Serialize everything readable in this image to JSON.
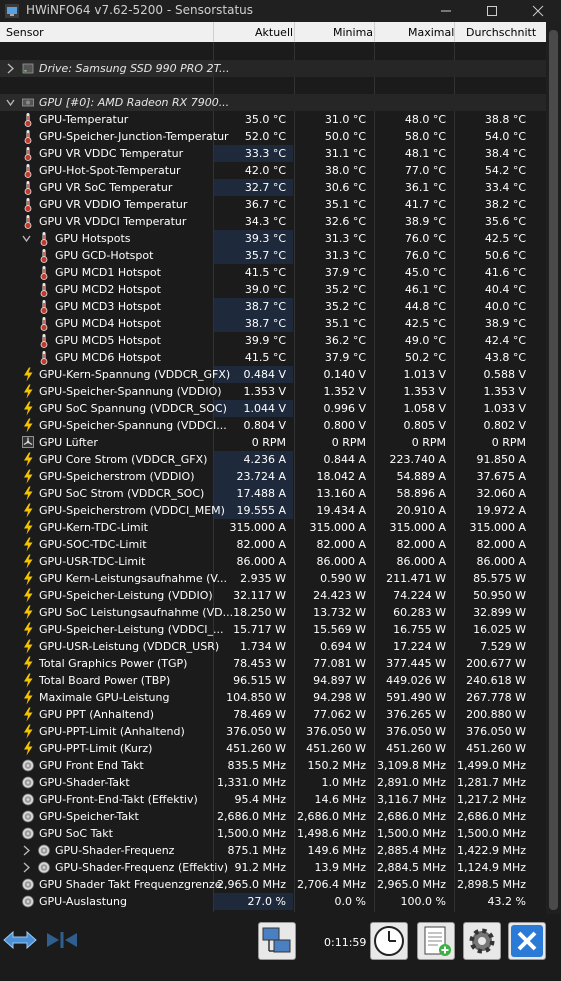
{
  "window": {
    "title": "HWiNFO64 v7.62-5200 - Sensorstatus"
  },
  "columns": {
    "sensor": "Sensor",
    "current": "Aktuell",
    "min": "Minimal",
    "max": "Maximal",
    "avg": "Durchschnitt"
  },
  "groups": [
    {
      "label": "Drive: Samsung SSD 990 PRO 2T..."
    },
    {
      "label": "GPU [#0]: AMD Radeon RX 7900..."
    }
  ],
  "rows": [
    {
      "name": "GPU-Temperatur",
      "icon": "thermometer-icon",
      "cur": "35.0 °C",
      "min": "31.0 °C",
      "max": "48.0 °C",
      "avg": "38.8 °C"
    },
    {
      "name": "GPU-Speicher-Junction-Temperatur",
      "icon": "thermometer-icon",
      "cur": "52.0 °C",
      "min": "50.0 °C",
      "max": "58.0 °C",
      "avg": "54.0 °C"
    },
    {
      "name": "GPU VR VDDC Temperatur",
      "icon": "thermometer-icon",
      "cur": "33.3 °C",
      "min": "31.1 °C",
      "max": "48.1 °C",
      "avg": "38.4 °C",
      "bar": true
    },
    {
      "name": "GPU-Hot-Spot-Temperatur",
      "icon": "thermometer-icon",
      "cur": "42.0 °C",
      "min": "38.0 °C",
      "max": "77.0 °C",
      "avg": "54.2 °C"
    },
    {
      "name": "GPU VR SoC Temperatur",
      "icon": "thermometer-icon",
      "cur": "32.7 °C",
      "min": "30.6 °C",
      "max": "36.1 °C",
      "avg": "33.4 °C",
      "bar": true
    },
    {
      "name": "GPU VR VDDIO Temperatur",
      "icon": "thermometer-icon",
      "cur": "36.7 °C",
      "min": "35.1 °C",
      "max": "41.7 °C",
      "avg": "38.2 °C"
    },
    {
      "name": "GPU VR VDDCI Temperatur",
      "icon": "thermometer-icon",
      "cur": "34.3 °C",
      "min": "32.6 °C",
      "max": "38.9 °C",
      "avg": "35.6 °C"
    },
    {
      "name": "GPU Hotspots",
      "icon": "thermometer-icon",
      "cur": "39.3 °C",
      "min": "31.3 °C",
      "max": "76.0 °C",
      "avg": "42.5 °C",
      "indent": 1,
      "expander": "down",
      "bar": true
    },
    {
      "name": "GPU GCD-Hotspot",
      "icon": "thermometer-icon",
      "cur": "35.7 °C",
      "min": "31.3 °C",
      "max": "76.0 °C",
      "avg": "50.6 °C",
      "indent": 1,
      "bar": true
    },
    {
      "name": "GPU MCD1 Hotspot",
      "icon": "thermometer-icon",
      "cur": "41.5 °C",
      "min": "37.9 °C",
      "max": "45.0 °C",
      "avg": "41.6 °C",
      "indent": 1
    },
    {
      "name": "GPU MCD2 Hotspot",
      "icon": "thermometer-icon",
      "cur": "39.0 °C",
      "min": "35.2 °C",
      "max": "46.1 °C",
      "avg": "40.4 °C",
      "indent": 1
    },
    {
      "name": "GPU MCD3 Hotspot",
      "icon": "thermometer-icon",
      "cur": "38.7 °C",
      "min": "35.2 °C",
      "max": "44.8 °C",
      "avg": "40.0 °C",
      "indent": 1,
      "bar": true
    },
    {
      "name": "GPU MCD4 Hotspot",
      "icon": "thermometer-icon",
      "cur": "38.7 °C",
      "min": "35.1 °C",
      "max": "42.5 °C",
      "avg": "38.9 °C",
      "indent": 1,
      "bar": true
    },
    {
      "name": "GPU MCD5 Hotspot",
      "icon": "thermometer-icon",
      "cur": "39.9 °C",
      "min": "36.2 °C",
      "max": "49.0 °C",
      "avg": "42.4 °C",
      "indent": 1
    },
    {
      "name": "GPU MCD6 Hotspot",
      "icon": "thermometer-icon",
      "cur": "41.5 °C",
      "min": "37.9 °C",
      "max": "50.2 °C",
      "avg": "43.8 °C",
      "indent": 1
    },
    {
      "name": "GPU-Kern-Spannung (VDDCR_GFX)",
      "icon": "lightning-icon",
      "cur": "0.484 V",
      "min": "0.140 V",
      "max": "1.013 V",
      "avg": "0.588 V",
      "bar": true
    },
    {
      "name": "GPU-Speicher-Spannung (VDDIO)",
      "icon": "lightning-icon",
      "cur": "1.353 V",
      "min": "1.352 V",
      "max": "1.353 V",
      "avg": "1.353 V"
    },
    {
      "name": "GPU SoC Spannung (VDDCR_SOC)",
      "icon": "lightning-icon",
      "cur": "1.044 V",
      "min": "0.996 V",
      "max": "1.058 V",
      "avg": "1.033 V",
      "bar": true
    },
    {
      "name": "GPU-Speicher-Spannung (VDDCI...",
      "icon": "lightning-icon",
      "cur": "0.804 V",
      "min": "0.800 V",
      "max": "0.805 V",
      "avg": "0.802 V"
    },
    {
      "name": "GPU Lüfter",
      "icon": "fan-icon",
      "cur": "0 RPM",
      "min": "0 RPM",
      "max": "0 RPM",
      "avg": "0 RPM"
    },
    {
      "name": "GPU Core Strom (VDDCR_GFX)",
      "icon": "lightning-icon",
      "cur": "4.236 A",
      "min": "0.844 A",
      "max": "223.740 A",
      "avg": "91.850 A",
      "bar": true
    },
    {
      "name": "GPU-Speicherstrom (VDDIO)",
      "icon": "lightning-icon",
      "cur": "23.724 A",
      "min": "18.042 A",
      "max": "54.889 A",
      "avg": "37.675 A",
      "bar": true
    },
    {
      "name": "GPU SoC Strom (VDDCR_SOC)",
      "icon": "lightning-icon",
      "cur": "17.488 A",
      "min": "13.160 A",
      "max": "58.896 A",
      "avg": "32.060 A",
      "bar": true
    },
    {
      "name": "GPU-Speicherstrom (VDDCI_MEM)",
      "icon": "lightning-icon",
      "cur": "19.555 A",
      "min": "19.434 A",
      "max": "20.910 A",
      "avg": "19.972 A",
      "bar": true
    },
    {
      "name": "GPU-Kern-TDC-Limit",
      "icon": "lightning-icon",
      "cur": "315.000 A",
      "min": "315.000 A",
      "max": "315.000 A",
      "avg": "315.000 A"
    },
    {
      "name": "GPU-SOC-TDC-Limit",
      "icon": "lightning-icon",
      "cur": "82.000 A",
      "min": "82.000 A",
      "max": "82.000 A",
      "avg": "82.000 A"
    },
    {
      "name": "GPU-USR-TDC-Limit",
      "icon": "lightning-icon",
      "cur": "86.000 A",
      "min": "86.000 A",
      "max": "86.000 A",
      "avg": "86.000 A"
    },
    {
      "name": "GPU Kern-Leistungsaufnahme (V...",
      "icon": "lightning-icon",
      "cur": "2.935 W",
      "min": "0.590 W",
      "max": "211.471 W",
      "avg": "85.575 W"
    },
    {
      "name": "GPU-Speicher-Leistung (VDDIO)",
      "icon": "lightning-icon",
      "cur": "32.117 W",
      "min": "24.423 W",
      "max": "74.224 W",
      "avg": "50.950 W"
    },
    {
      "name": "GPU SoC Leistungsaufnahme (VD...",
      "icon": "lightning-icon",
      "cur": "18.250 W",
      "min": "13.732 W",
      "max": "60.283 W",
      "avg": "32.899 W"
    },
    {
      "name": "GPU-Speicher-Leistung (VDDCI_...",
      "icon": "lightning-icon",
      "cur": "15.717 W",
      "min": "15.569 W",
      "max": "16.755 W",
      "avg": "16.025 W"
    },
    {
      "name": "GPU-USR-Leistung (VDDCR_USR)",
      "icon": "lightning-icon",
      "cur": "1.734 W",
      "min": "0.694 W",
      "max": "17.224 W",
      "avg": "7.529 W"
    },
    {
      "name": "Total Graphics Power (TGP)",
      "icon": "lightning-icon",
      "cur": "78.453 W",
      "min": "77.081 W",
      "max": "377.445 W",
      "avg": "200.677 W"
    },
    {
      "name": "Total Board Power (TBP)",
      "icon": "lightning-icon",
      "cur": "96.515 W",
      "min": "94.897 W",
      "max": "449.026 W",
      "avg": "240.618 W"
    },
    {
      "name": "Maximale GPU-Leistung",
      "icon": "lightning-icon",
      "cur": "104.850 W",
      "min": "94.298 W",
      "max": "591.490 W",
      "avg": "267.778 W"
    },
    {
      "name": "GPU PPT (Anhaltend)",
      "icon": "lightning-icon",
      "cur": "78.469 W",
      "min": "77.062 W",
      "max": "376.265 W",
      "avg": "200.880 W"
    },
    {
      "name": "GPU-PPT-Limit (Anhaltend)",
      "icon": "lightning-icon",
      "cur": "376.050 W",
      "min": "376.050 W",
      "max": "376.050 W",
      "avg": "376.050 W"
    },
    {
      "name": "GPU-PPT-Limit (Kurz)",
      "icon": "lightning-icon",
      "cur": "451.260 W",
      "min": "451.260 W",
      "max": "451.260 W",
      "avg": "451.260 W"
    },
    {
      "name": "GPU Front End Takt",
      "icon": "clock-icon",
      "cur": "835.5 MHz",
      "min": "150.2 MHz",
      "max": "3,109.8 MHz",
      "avg": "1,499.0 MHz"
    },
    {
      "name": "GPU-Shader-Takt",
      "icon": "clock-icon",
      "cur": "1,331.0 MHz",
      "min": "1.0 MHz",
      "max": "2,891.0 MHz",
      "avg": "1,281.7 MHz"
    },
    {
      "name": "GPU-Front-End-Takt (Effektiv)",
      "icon": "clock-icon",
      "cur": "95.4 MHz",
      "min": "14.6 MHz",
      "max": "3,116.7 MHz",
      "avg": "1,217.2 MHz"
    },
    {
      "name": "GPU-Speicher-Takt",
      "icon": "clock-icon",
      "cur": "2,686.0 MHz",
      "min": "2,686.0 MHz",
      "max": "2,686.0 MHz",
      "avg": "2,686.0 MHz"
    },
    {
      "name": "GPU SoC Takt",
      "icon": "clock-icon",
      "cur": "1,500.0 MHz",
      "min": "1,498.6 MHz",
      "max": "1,500.0 MHz",
      "avg": "1,500.0 MHz"
    },
    {
      "name": "GPU-Shader-Frequenz",
      "icon": "clock-icon",
      "cur": "875.1 MHz",
      "min": "149.6 MHz",
      "max": "2,885.4 MHz",
      "avg": "1,422.9 MHz",
      "indent": 1,
      "expander": "right"
    },
    {
      "name": "GPU-Shader-Frequenz (Effektiv)",
      "icon": "clock-icon",
      "cur": "91.2 MHz",
      "min": "13.9 MHz",
      "max": "2,884.5 MHz",
      "avg": "1,124.9 MHz",
      "indent": 1,
      "expander": "right"
    },
    {
      "name": "GPU Shader Takt Frequenzgrenze",
      "icon": "clock-icon",
      "cur": "2,965.0 MHz",
      "min": "2,706.4 MHz",
      "max": "2,965.0 MHz",
      "avg": "2,898.5 MHz"
    },
    {
      "name": "GPU-Auslastung",
      "icon": "clock-icon",
      "cur": "27.0 %",
      "min": "0.0 %",
      "max": "100.0 %",
      "avg": "43.2 %",
      "bar": true
    }
  ],
  "toolbar": {
    "elapsed": "0:11:59"
  },
  "colors": {
    "accent_bar": "#1e2a3c",
    "lightning": "#f5c400",
    "thermometer_bulb": "#c0392b",
    "close_button": "#2b7bd6"
  }
}
